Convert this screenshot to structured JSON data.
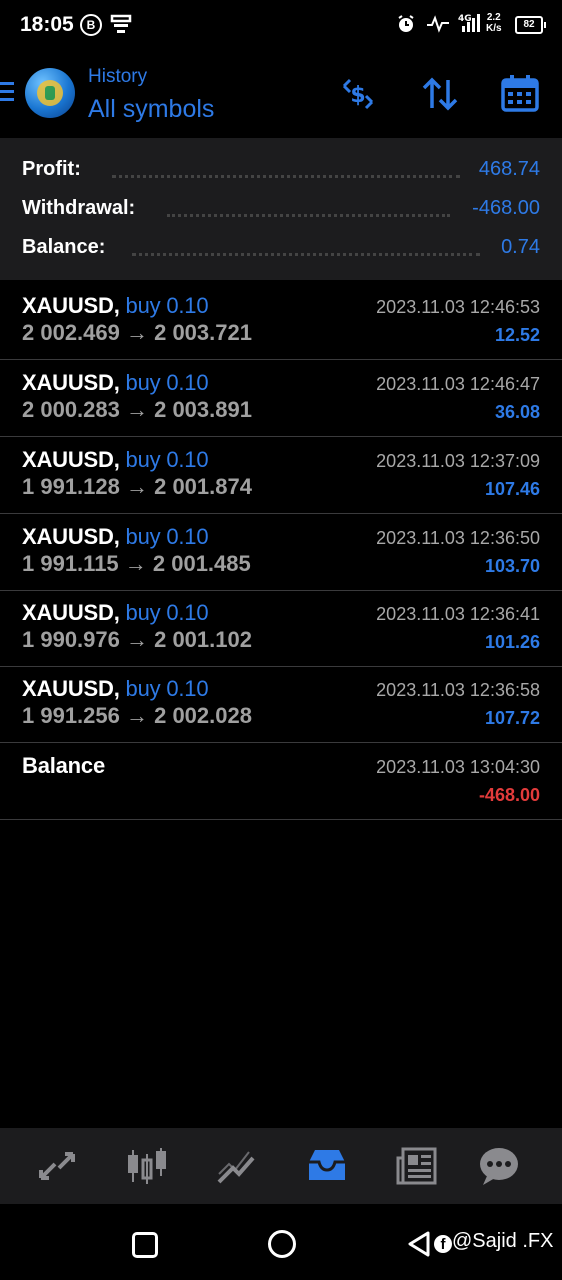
{
  "status_bar": {
    "time": "18:05",
    "b_badge": "B",
    "network": "4G",
    "speed_top": "2.2",
    "speed_bottom": "K/s",
    "battery": "82"
  },
  "header": {
    "subtitle": "History",
    "title": "All symbols",
    "icons": [
      "menu-icon",
      "app-logo",
      "currency-filter-icon",
      "sort-icon",
      "calendar-icon"
    ]
  },
  "summary": {
    "profit_label": "Profit:",
    "profit_value": "468.74",
    "withdrawal_label": "Withdrawal:",
    "withdrawal_value": "-468.00",
    "balance_label": "Balance:",
    "balance_value": "0.74"
  },
  "deals": [
    {
      "symbol": "XAUUSD,",
      "side": "buy 0.10",
      "prices": "2 002.469 → 2 003.721",
      "time": "2023.11.03 12:46:53",
      "profit": "12.52"
    },
    {
      "symbol": "XAUUSD,",
      "side": "buy 0.10",
      "prices": "2 000.283 → 2 003.891",
      "time": "2023.11.03 12:46:47",
      "profit": "36.08"
    },
    {
      "symbol": "XAUUSD,",
      "side": "buy 0.10",
      "prices": "1 991.128 → 2 001.874",
      "time": "2023.11.03 12:37:09",
      "profit": "107.46"
    },
    {
      "symbol": "XAUUSD,",
      "side": "buy 0.10",
      "prices": "1 991.115 → 2 001.485",
      "time": "2023.11.03 12:36:50",
      "profit": "103.70"
    },
    {
      "symbol": "XAUUSD,",
      "side": "buy 0.10",
      "prices": "1 990.976 → 2 001.102",
      "time": "2023.11.03 12:36:41",
      "profit": "101.26"
    },
    {
      "symbol": "XAUUSD,",
      "side": "buy 0.10",
      "prices": "1 991.256 → 2 002.028",
      "time": "2023.11.03 12:36:58",
      "profit": "107.72"
    }
  ],
  "balance_entry": {
    "label": "Balance",
    "time": "2023.11.03 13:04:30",
    "amount": "-468.00"
  },
  "bottom_nav": {
    "items": [
      "quotes-icon",
      "chart-icon",
      "trade-icon",
      "history-icon",
      "news-icon",
      "chat-icon"
    ],
    "active": "history-icon"
  },
  "watermark": "@Sajid .FX",
  "colors": {
    "accent": "#2e7ae6",
    "negative": "#e23b3b",
    "panel": "#1c1c1e",
    "background": "#000000"
  }
}
